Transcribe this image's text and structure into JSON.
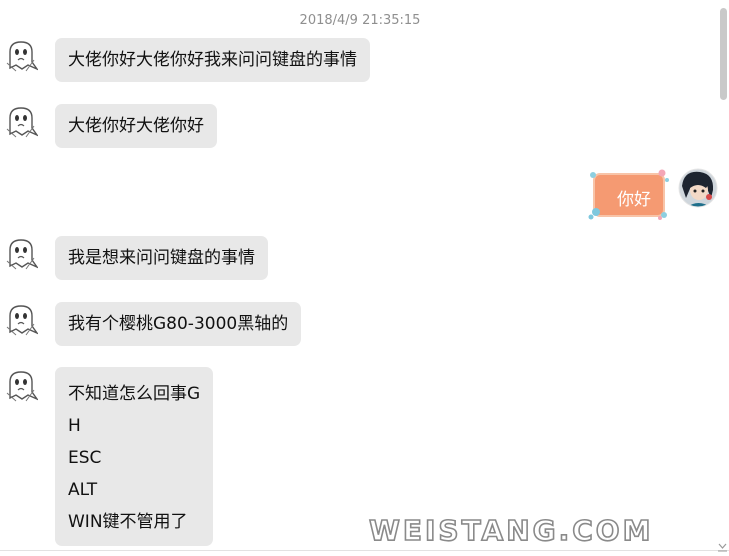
{
  "timestamp": "2018/4/9 21:35:15",
  "messages": [
    {
      "side": "left",
      "lines": [
        "大佬你好大佬你好我来问问键盘的事情"
      ]
    },
    {
      "side": "left",
      "lines": [
        "大佬你好大佬你好"
      ]
    },
    {
      "side": "right",
      "lines": [
        "你好"
      ]
    },
    {
      "side": "left",
      "lines": [
        "我是想来问问键盘的事情"
      ]
    },
    {
      "side": "left",
      "lines": [
        "我有个樱桃G80-3000黑轴的"
      ]
    },
    {
      "side": "left",
      "lines": [
        "不知道怎么回事G",
        "H",
        "ESC",
        "ALT",
        "WIN键不管用了"
      ]
    }
  ],
  "watermark": "WEISTANG.COM",
  "colors": {
    "bubble_bg": "#e8e8e8",
    "my_bubble_bg": "#f59a72",
    "timestamp": "#8f8f8f",
    "scrollbar_thumb": "#c9c9c9"
  },
  "icons": {
    "other_avatar": "ghost-avatar-icon",
    "my_avatar": "user-avatar-icon",
    "resize": "resize-grip-icon"
  }
}
